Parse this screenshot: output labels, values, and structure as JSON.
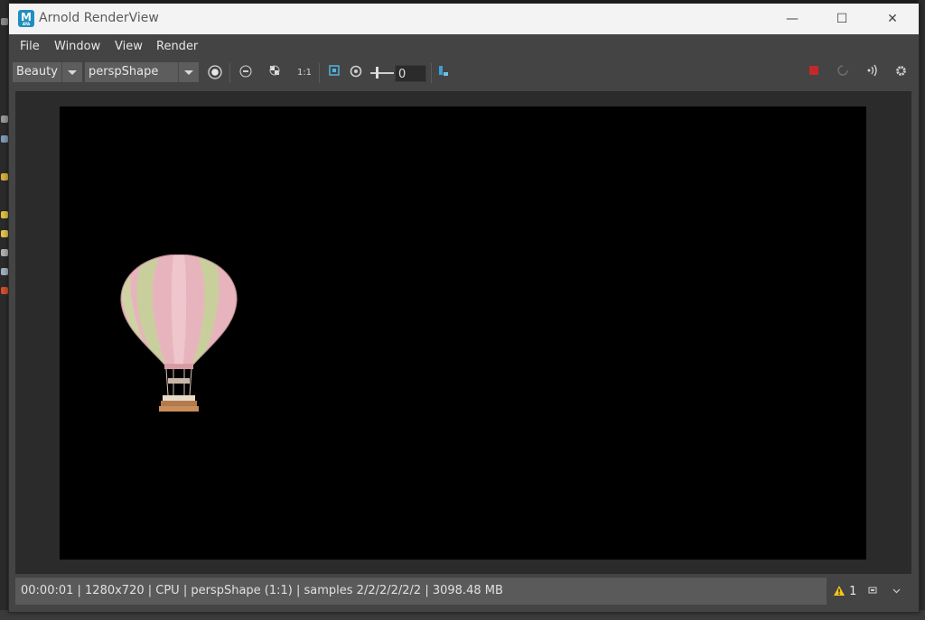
{
  "window": {
    "title": "Arnold RenderView",
    "app_icon_letter": "M",
    "app_icon_sub": "AYA",
    "accent_color": "#1f8fbf"
  },
  "window_controls": {
    "minimize": "—",
    "maximize": "☐",
    "close": "✕"
  },
  "menu": [
    "File",
    "Window",
    "View",
    "Render"
  ],
  "toolbar": {
    "aov_dropdown": "Beauty",
    "camera_dropdown": "perspShape",
    "one_to_one_label": "1:1",
    "exposure_value": "0",
    "icons": [
      "render-region-icon",
      "histogram-icon",
      "checker-icon",
      "one-to-one-icon",
      "crop-icon",
      "lut-icon",
      "snapshot-icon",
      "stop-icon",
      "refresh-icon",
      "ipr-icon",
      "settings-icon"
    ],
    "stop_color": "#c4292a"
  },
  "status": {
    "text": "00:00:01 | 1280x720 | CPU | perspShape (1:1) | samples 2/2/2/2/2/2 | 3098.48 MB",
    "warning_count": "1",
    "warning_color": "#f5c518"
  }
}
